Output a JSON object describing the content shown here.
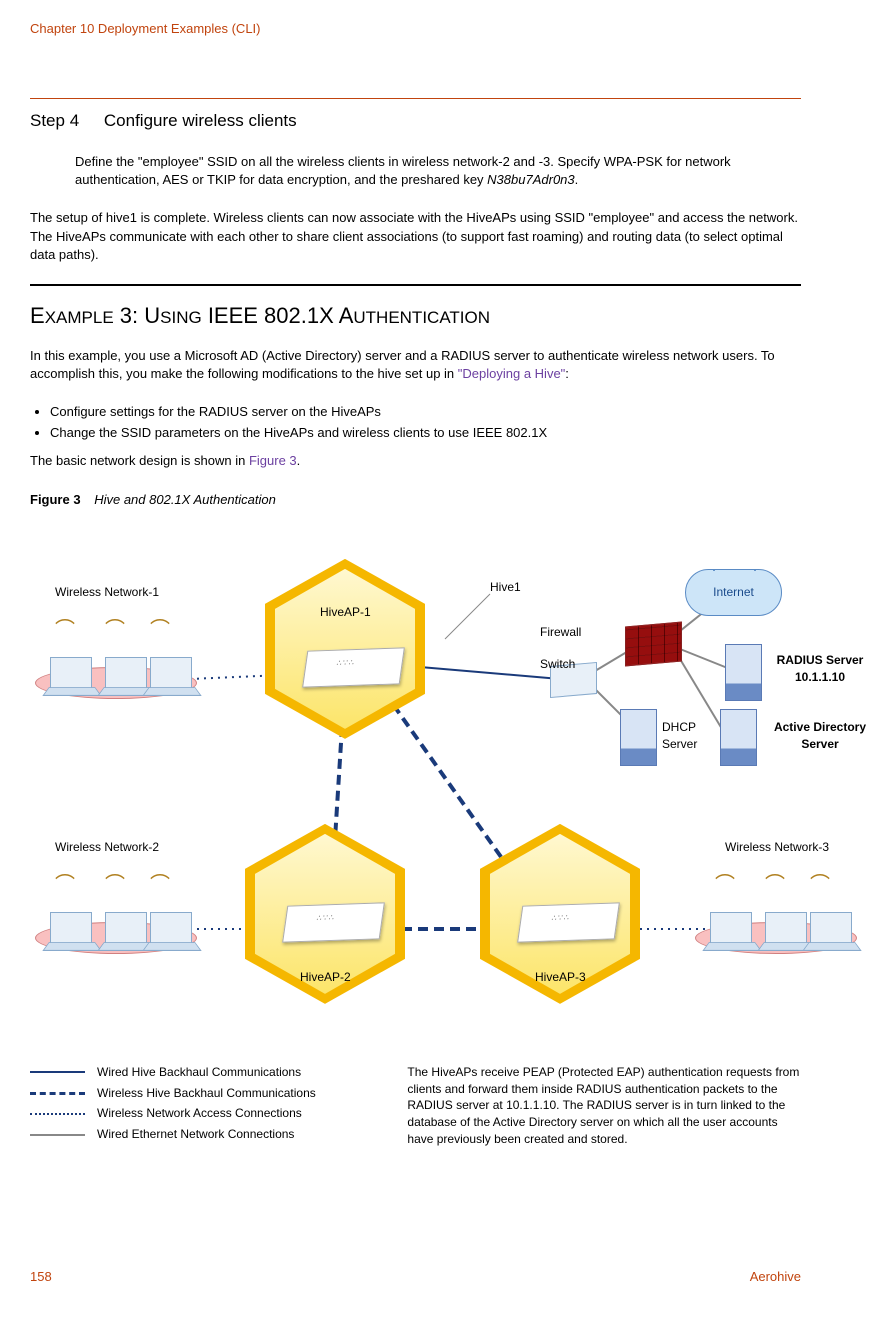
{
  "header": {
    "chapter": "Chapter 10 Deployment Examples (CLI)"
  },
  "step": {
    "num": "Step 4",
    "title": "Configure wireless clients",
    "body_pre": "Define the \"employee\" SSID on all the wireless clients in wireless network-2 and -3. Specify WPA-PSK for network authentication, AES or TKIP for data encryption, and the preshared key ",
    "body_key": "N38bu7Adr0n3",
    "body_post": "."
  },
  "setup_para": "The setup of hive1 is complete. Wireless clients can now associate with the HiveAPs using SSID \"employee\" and access the network. The HiveAPs communicate with each other to share client associations (to support fast roaming) and routing data (to select optimal data paths).",
  "example": {
    "title_pre": "E",
    "title_sc1": "XAMPLE",
    "title_mid": " 3: U",
    "title_sc2": "SING",
    "title_ieee": " IEEE 802.1X A",
    "title_sc3": "UTHENTICATION",
    "intro_pre": "In this example, you use a Microsoft AD (Active Directory) server and a RADIUS server to authenticate wireless network users. To accomplish this, you make the following modifications to the hive set up in ",
    "intro_link": "\"Deploying a Hive\"",
    "intro_post": ":",
    "bullets": [
      "Configure settings for the RADIUS server on the HiveAPs",
      "Change the SSID parameters on the HiveAPs and wireless clients to use IEEE 802.1X"
    ],
    "design_pre": "The basic network design is shown in ",
    "design_link": "Figure 3",
    "design_post": "."
  },
  "figure": {
    "num": "Figure 3",
    "title": "Hive and 802.1X Authentication"
  },
  "diagram": {
    "net1": "Wireless Network-1",
    "net2": "Wireless Network-2",
    "net3": "Wireless Network-3",
    "ap1": "HiveAP-1",
    "ap2": "HiveAP-2",
    "ap3": "HiveAP-3",
    "hive": "Hive1",
    "firewall": "Firewall",
    "switch": "Switch",
    "internet": "Internet",
    "dhcp_l1": "DHCP",
    "dhcp_l2": "Server",
    "radius_l1": "RADIUS Server",
    "radius_l2": "10.1.1.10",
    "ad_l1": "Active Directory",
    "ad_l2": "Server"
  },
  "legend": {
    "l1": "Wired Hive Backhaul Communications",
    "l2": "Wireless Hive Backhaul Communications",
    "l3": "Wireless Network Access Connections",
    "l4": "Wired Ethernet Network Connections",
    "desc": "The HiveAPs receive PEAP (Protected EAP) authentication requests from clients and forward them inside RADIUS authentication packets to the RADIUS server at 10.1.1.10. The RADIUS server is in turn linked to the database of the Active Directory server on which all the user accounts have previously been created and stored."
  },
  "footer": {
    "page": "158",
    "brand": "Aerohive"
  }
}
